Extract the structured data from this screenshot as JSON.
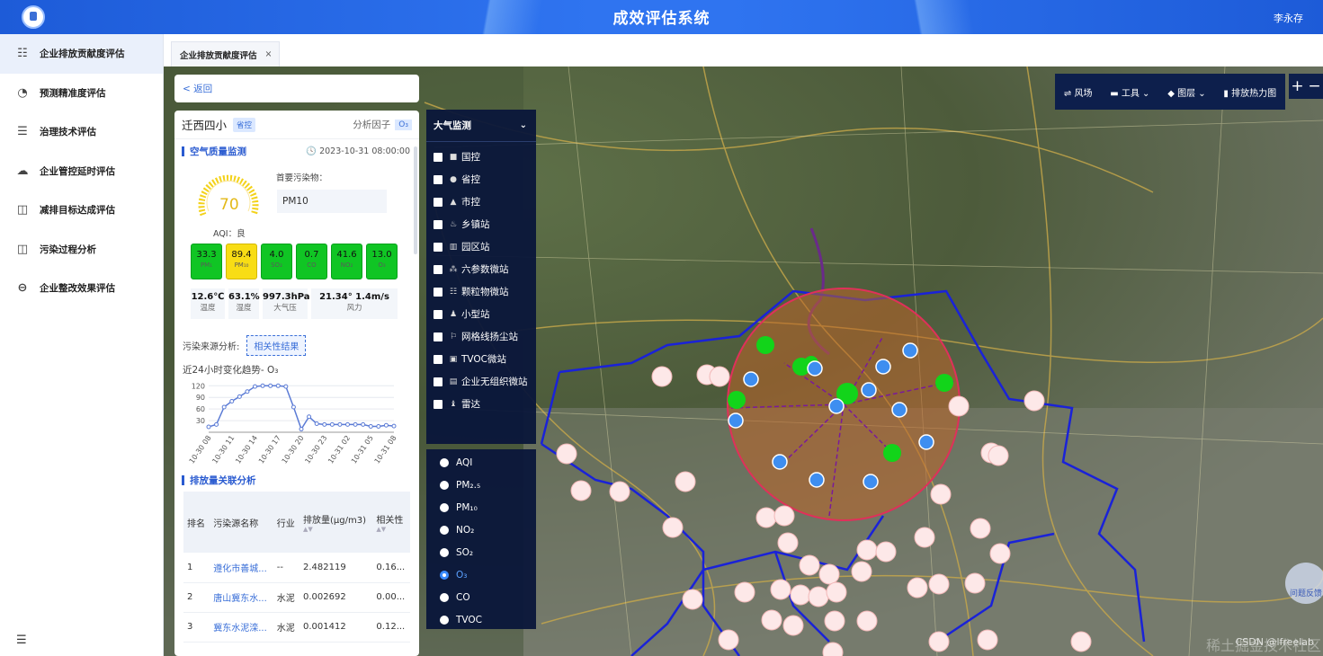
{
  "header": {
    "title": "成效评估系统",
    "user": "李永存"
  },
  "sidebar": {
    "items": [
      {
        "label": "企业排放贡献度评估",
        "icon": "list-tree-icon",
        "active": true
      },
      {
        "label": "预测精准度评估",
        "icon": "chart-check-icon"
      },
      {
        "label": "治理技术评估",
        "icon": "list-icon"
      },
      {
        "label": "企业管控延时评估",
        "icon": "cloud-upload-icon"
      },
      {
        "label": "减排目标达成评估",
        "icon": "target-icon"
      },
      {
        "label": "污染过程分析",
        "icon": "analysis-icon"
      },
      {
        "label": "企业整改效果评估",
        "icon": "minus-circle-icon"
      }
    ],
    "collapse_icon": "menu-collapse-icon"
  },
  "tabs": [
    {
      "label": "企业排放贡献度评估",
      "close": "×"
    }
  ],
  "back": {
    "label": "< 返回"
  },
  "station": {
    "name": "迁西四小",
    "tag": "省控",
    "factor_label": "分析因子",
    "factor_value": "O₃"
  },
  "air": {
    "title": "空气质量监测",
    "time": "2023-10-31 08:00:00",
    "aqi": "70",
    "aqi_label": "AQI：良",
    "primary_label": "首要污染物：",
    "primary_value": "PM10",
    "pollutants": [
      {
        "value": "33.3",
        "name": "PM₁",
        "color": "#10c524"
      },
      {
        "value": "89.4",
        "name": "PM₁₀",
        "color": "#f8dd15"
      },
      {
        "value": "4.0",
        "name": "SO₂",
        "color": "#10c524"
      },
      {
        "value": "0.7",
        "name": "CO",
        "color": "#10c524"
      },
      {
        "value": "41.6",
        "name": "NO₂",
        "color": "#10c524"
      },
      {
        "value": "13.0",
        "name": "O₃",
        "color": "#10c524"
      }
    ],
    "weather": [
      {
        "value": "12.6℃",
        "name": "温度"
      },
      {
        "value": "63.1%",
        "name": "湿度"
      },
      {
        "value": "997.3hPa",
        "name": "大气压"
      },
      {
        "value": "21.34° 1.4m/s",
        "name": "风力"
      }
    ]
  },
  "source": {
    "label": "污染来源分析:",
    "button": "相关性结果"
  },
  "trend": {
    "title": "近24小时变化趋势- O₃"
  },
  "chart_data": {
    "type": "line",
    "title": "近24小时变化趋势- O₃",
    "x": [
      "10-30 08",
      "10-30 09",
      "10-30 10",
      "10-30 11",
      "10-30 12",
      "10-30 13",
      "10-30 14",
      "10-30 15",
      "10-30 16",
      "10-30 17",
      "10-30 18",
      "10-30 19",
      "10-30 20",
      "10-30 21",
      "10-30 22",
      "10-30 23",
      "10-31 00",
      "10-31 01",
      "10-31 02",
      "10-31 03",
      "10-31 04",
      "10-31 05",
      "10-31 06",
      "10-31 07",
      "10-31 08"
    ],
    "x_ticks": [
      "10-30 08",
      "10-30 11",
      "10-30 14",
      "10-30 17",
      "10-30 20",
      "10-30 23",
      "10-31 02",
      "10-31 05",
      "10-31 08"
    ],
    "y_ticks": [
      30,
      60,
      90,
      120
    ],
    "series": [
      {
        "values": [
          14,
          20,
          65,
          80,
          92,
          105,
          118,
          120,
          120,
          120,
          118,
          65,
          8,
          40,
          22,
          20,
          20,
          20,
          20,
          20,
          20,
          15,
          15,
          18,
          16
        ]
      }
    ],
    "ylim": [
      0,
      130
    ]
  },
  "emission": {
    "title": "排放量关联分析",
    "columns": [
      "排名",
      "污染源名称",
      "行业",
      "排放量(μg/m3)",
      "相关性"
    ],
    "rows": [
      [
        "1",
        "遵化市善城...",
        "--",
        "2.482119",
        "0.16..."
      ],
      [
        "2",
        "唐山冀东水...",
        "水泥",
        "0.002692",
        "0.00..."
      ],
      [
        "3",
        "冀东水泥滦...",
        "水泥",
        "0.001412",
        "0.12..."
      ]
    ]
  },
  "layer_panel": {
    "title": "大气监测",
    "items": [
      {
        "label": "国控",
        "icon": "■"
      },
      {
        "label": "省控",
        "icon": "●"
      },
      {
        "label": "市控",
        "icon": "▲"
      },
      {
        "label": "乡镇站",
        "icon": "♨"
      },
      {
        "label": "园区站",
        "icon": "▥"
      },
      {
        "label": "六参数微站",
        "icon": "⁂"
      },
      {
        "label": "颗粒物微站",
        "icon": "☷"
      },
      {
        "label": "小型站",
        "icon": "♟"
      },
      {
        "label": "网格线扬尘站",
        "icon": "⚐"
      },
      {
        "label": "TVOC微站",
        "icon": "▣"
      },
      {
        "label": "企业无组织微站",
        "icon": "▤"
      },
      {
        "label": "雷达",
        "icon": "♝"
      }
    ]
  },
  "factor_panel": {
    "items": [
      "AQI",
      "PM₂.₅",
      "PM₁₀",
      "NO₂",
      "SO₂",
      "O₃",
      "CO",
      "TVOC"
    ],
    "selected": "O₃"
  },
  "map_toolbar": {
    "items": [
      "⇌ 风场",
      "▬ 工具 ⌄",
      "◆ 图层 ⌄",
      "▮ 排放热力图"
    ],
    "zoom_in": "+",
    "zoom_out": "−"
  },
  "feedback": "问题反馈",
  "watermark": "CSDN @lfreelab",
  "watermark2": "稀土掘金技术社区"
}
